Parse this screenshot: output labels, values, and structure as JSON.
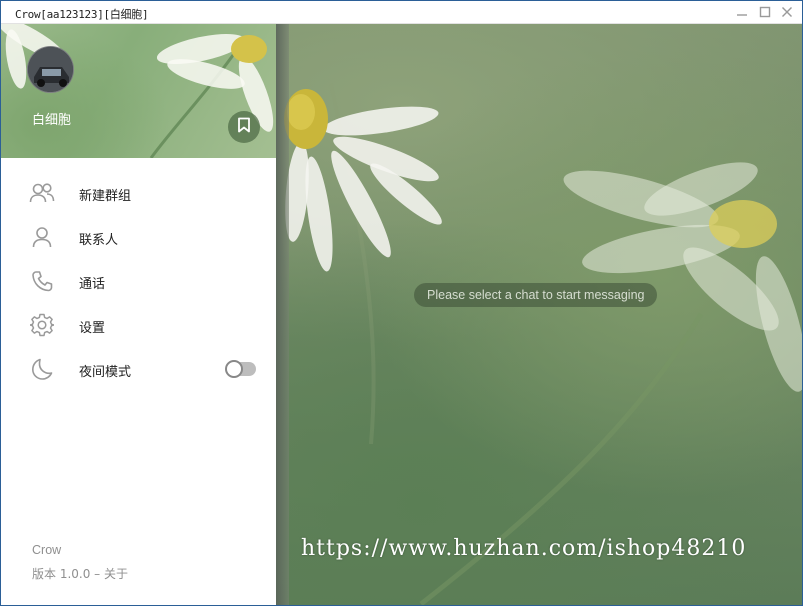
{
  "window": {
    "title": "Crow[aa123123][白细胞]",
    "controls": [
      "minimize-icon",
      "maximize-icon",
      "close-icon"
    ]
  },
  "drawer": {
    "username": "白细胞",
    "saved_messages_icon": "bookmark-icon",
    "menu": [
      {
        "label": "新建群组",
        "icon": "group-icon"
      },
      {
        "label": "联系人",
        "icon": "contact-icon"
      },
      {
        "label": "通话",
        "icon": "phone-icon"
      },
      {
        "label": "设置",
        "icon": "gear-icon"
      },
      {
        "label": "夜间模式",
        "icon": "moon-icon",
        "toggle": false
      }
    ],
    "footer": {
      "app_name": "Crow",
      "version": "版本 1.0.0 – 关于"
    }
  },
  "chat": {
    "hint": "Please select a chat to start messaging"
  },
  "watermark": "https://www.huzhan.com/ishop48210",
  "colors": {
    "accent": "#5a7e55",
    "icon": "#9a9a9a",
    "text": "#222222",
    "muted": "#8f8f8f"
  }
}
